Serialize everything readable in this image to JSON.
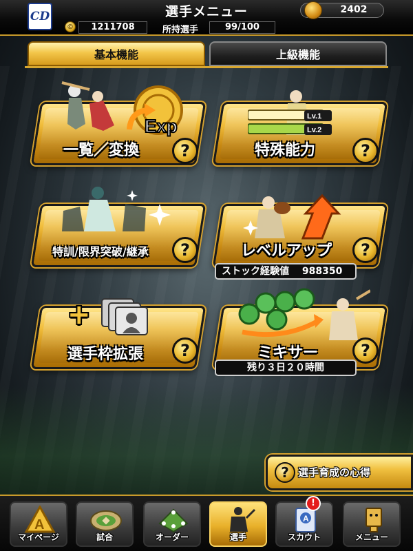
{
  "header": {
    "team_logo_text": "CD",
    "title": "選手メニュー",
    "gold_count": "2402",
    "coins": "1211708",
    "roster_label": "所持選手",
    "roster_count": "99/100"
  },
  "tabs": [
    {
      "label": "基本機能",
      "active": true
    },
    {
      "label": "上級機能",
      "active": false
    }
  ],
  "tiles": [
    {
      "label": "一覧／変換",
      "icon": "exp-convert-icon"
    },
    {
      "label": "特殊能力",
      "icon": "special-ability-icon",
      "levels": [
        "Lv.1",
        "Lv.2"
      ]
    },
    {
      "label": "特訓/限界突破/継承",
      "icon": "training-icon"
    },
    {
      "label": "レベルアップ",
      "icon": "level-up-icon",
      "info": {
        "label": "ストック経験値",
        "value": "988350"
      }
    },
    {
      "label": "選手枠拡張",
      "icon": "expand-slots-icon",
      "plus": "+"
    },
    {
      "label": "ミキサー",
      "icon": "mixer-icon",
      "info": {
        "label": "残り３日２０時間"
      }
    }
  ],
  "help_glyph": "?",
  "tips": {
    "label": "選手育成の心得",
    "glyph": "?"
  },
  "nav": [
    {
      "label": "マイページ",
      "icon": "mypage-icon",
      "glyph": "A",
      "active": false
    },
    {
      "label": "試合",
      "icon": "stadium-icon",
      "active": false
    },
    {
      "label": "オーダー",
      "icon": "order-icon",
      "active": false
    },
    {
      "label": "選手",
      "icon": "player-icon",
      "active": true
    },
    {
      "label": "スカウト",
      "icon": "scout-icon",
      "active": false
    },
    {
      "label": "メニュー",
      "icon": "menu-icon",
      "active": false
    }
  ],
  "scout_badge": "!",
  "colors": {
    "gold": "#f1bd3a",
    "gold_dark": "#a86c05",
    "accent_orange": "#ff7a1a",
    "badge_red": "#e41b1b",
    "team_blue": "#1b3a8c"
  }
}
